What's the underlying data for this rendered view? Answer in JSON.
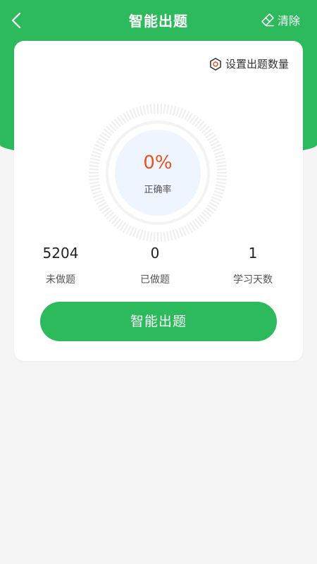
{
  "header": {
    "title": "智能出题",
    "clear_label": "清除"
  },
  "card": {
    "settings_label": "设置出题数量",
    "accuracy": {
      "value": "0%",
      "label": "正确率"
    },
    "stats": [
      {
        "value": "5204",
        "label": "未做题"
      },
      {
        "value": "0",
        "label": "已做题"
      },
      {
        "value": "1",
        "label": "学习天数"
      }
    ],
    "button_label": "智能出题"
  },
  "icons": {
    "back": "chevron-left-icon",
    "clear": "eraser-icon",
    "settings": "gear-icon"
  },
  "colors": {
    "brand_green": "#2dba5c",
    "accuracy_orange": "#e8531f",
    "gauge_inner": "#eef5fe",
    "page_background": "#f5f5f5"
  }
}
